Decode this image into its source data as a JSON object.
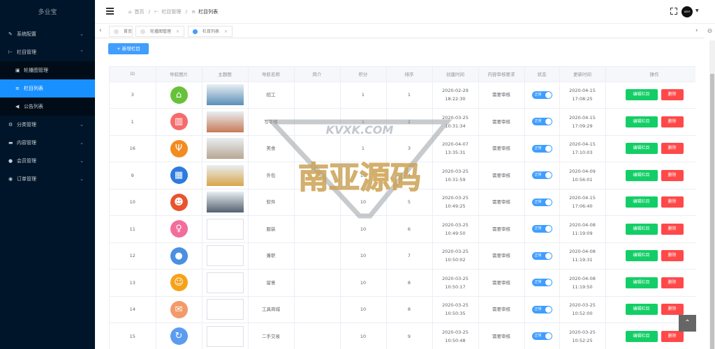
{
  "sidebar": {
    "logo": "多业宝",
    "items": [
      {
        "label": "系统配置",
        "icon": "wrench-icon",
        "expanded": false
      },
      {
        "label": "栏目管理",
        "icon": "column-icon",
        "expanded": true
      },
      {
        "label": "轮播图管理",
        "icon": "image-icon",
        "sub": true
      },
      {
        "label": "栏目列表",
        "icon": "list-icon",
        "sub": true,
        "active": true
      },
      {
        "label": "公告列表",
        "icon": "megaphone-icon",
        "sub": true
      },
      {
        "label": "分类管理",
        "icon": "gear-icon",
        "expanded": false
      },
      {
        "label": "内容管理",
        "icon": "folder-icon",
        "expanded": false
      },
      {
        "label": "会员管理",
        "icon": "user-icon",
        "expanded": false
      },
      {
        "label": "订单管理",
        "icon": "order-icon",
        "expanded": false
      }
    ]
  },
  "header": {
    "breadcrumbs": [
      "首页",
      "/",
      "栏目管理",
      "/",
      "栏目列表"
    ],
    "avatar_text": "user"
  },
  "tabs": [
    {
      "label": "首页",
      "active": false,
      "closable": false
    },
    {
      "label": "轮播图管理",
      "active": false,
      "closable": true
    },
    {
      "label": "栏目列表",
      "active": true,
      "closable": true
    }
  ],
  "add_button": "+ 新增栏目",
  "table": {
    "columns": [
      "ID",
      "导航图片",
      "主题图",
      "导航名称",
      "简介",
      "积分",
      "排序",
      "创建时间",
      "内容审核要求",
      "状态",
      "更新时间",
      "操作"
    ],
    "status_label": "正常",
    "edit_label": "编辑栏目",
    "delete_label": "删除",
    "rows": [
      {
        "id": "3",
        "icon": "house-icon",
        "icon_color": "#67c23a",
        "has_photo": true,
        "photo_color": "#5a8fb8",
        "name": "招工",
        "intro": "",
        "points": "1",
        "sort": "1",
        "created": "2020-02-29 18:22:30",
        "audit": "需要审核",
        "updated": "2020-04-15 17:08:25"
      },
      {
        "id": "1",
        "icon": "building-icon",
        "icon_color": "#f56c6c",
        "has_photo": true,
        "photo_color": "#c87a58",
        "name": "写字楼",
        "intro": "",
        "points": "1",
        "sort": "2",
        "created": "2020-03-25 10:31:34",
        "audit": "需要审核",
        "updated": "2020-04-15 17:09:29"
      },
      {
        "id": "16",
        "icon": "cutlery-icon",
        "icon_color": "#f28b22",
        "has_photo": true,
        "photo_color": "#b8a792",
        "name": "美食",
        "intro": "",
        "points": "1",
        "sort": "3",
        "created": "2020-04-07 13:35:31",
        "audit": "需要审核",
        "updated": "2020-04-15 17:10:03"
      },
      {
        "id": "9",
        "icon": "city-icon",
        "icon_color": "#2d7be0",
        "has_photo": true,
        "photo_color": "#d9a64b",
        "name": "外包",
        "intro": "",
        "points": "10",
        "sort": "4",
        "created": "2020-03-25 10:31:59",
        "audit": "需要审核",
        "updated": "2020-04-09 10:56:01"
      },
      {
        "id": "10",
        "icon": "android-icon",
        "icon_color": "#e8542f",
        "has_photo": true,
        "photo_color": "#556170",
        "name": "软件",
        "intro": "",
        "points": "10",
        "sort": "5",
        "created": "2020-03-25 10:49:25",
        "audit": "需要审核",
        "updated": "2020-04-15 17:06:40"
      },
      {
        "id": "11",
        "icon": "dress-icon",
        "icon_color": "#f26d9c",
        "has_photo": false,
        "name": "服装",
        "intro": "",
        "points": "10",
        "sort": "6",
        "created": "2020-03-25 10:49:50",
        "audit": "需要审核",
        "updated": "2020-04-08 11:19:09"
      },
      {
        "id": "12",
        "icon": "person-icon",
        "icon_color": "#4a90e2",
        "has_photo": false,
        "name": "兼职",
        "intro": "",
        "points": "10",
        "sort": "7",
        "created": "2020-03-25 10:50:02",
        "audit": "需要审核",
        "updated": "2020-04-08 11:19:31"
      },
      {
        "id": "13",
        "icon": "hand-person-icon",
        "icon_color": "#f5a21b",
        "has_photo": false,
        "name": "留意",
        "intro": "",
        "points": "10",
        "sort": "8",
        "created": "2020-03-25 10:50:17",
        "audit": "需要审核",
        "updated": "2020-04-08 11:19:50"
      },
      {
        "id": "14",
        "icon": "mail-icon",
        "icon_color": "#f39a6b",
        "has_photo": false,
        "name": "工具商城",
        "intro": "",
        "points": "10",
        "sort": "8",
        "created": "2020-03-25 10:50:35",
        "audit": "需要审核",
        "updated": "2020-03-25 10:52:00"
      },
      {
        "id": "15",
        "icon": "exchange-icon",
        "icon_color": "#5b9cf0",
        "has_photo": false,
        "name": "二手交易",
        "intro": "",
        "points": "10",
        "sort": "9",
        "created": "2020-03-25 10:50:48",
        "audit": "需要审核",
        "updated": "2020-03-25 10:52:25"
      }
    ]
  },
  "watermark": {
    "line1": "KVXK.COM",
    "line2": "南亚源码"
  }
}
